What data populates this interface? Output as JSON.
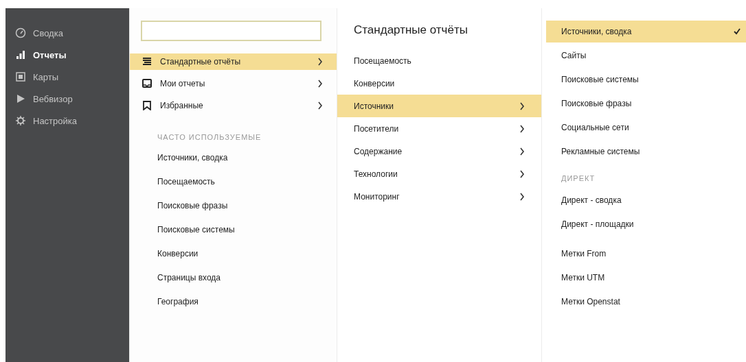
{
  "sidebar": {
    "items": [
      {
        "label": "Сводка",
        "selected": false
      },
      {
        "label": "Отчеты",
        "selected": true
      },
      {
        "label": "Карты",
        "selected": false
      },
      {
        "label": "Вебвизор",
        "selected": false
      },
      {
        "label": "Настройка",
        "selected": false
      }
    ]
  },
  "menu": {
    "items": [
      {
        "label": "Стандартные отчёты",
        "selected": true
      },
      {
        "label": "Мои отчеты",
        "selected": false
      },
      {
        "label": "Избранные",
        "selected": false
      }
    ],
    "frequent": {
      "heading": "ЧАСТО ИСПОЛЬЗУЕМЫЕ",
      "items": [
        "Источники, сводка",
        "Посещаемость",
        "Поисковые фразы",
        "Поисковые системы",
        "Конверсии",
        "Страницы входа",
        "География"
      ]
    }
  },
  "reports": {
    "title": "Стандартные отчёты",
    "items": [
      {
        "label": "Посещаемость",
        "submenu": false,
        "selected": false
      },
      {
        "label": "Конверсии",
        "submenu": false,
        "selected": false
      },
      {
        "label": "Источники",
        "submenu": true,
        "selected": true
      },
      {
        "label": "Посетители",
        "submenu": true,
        "selected": false
      },
      {
        "label": "Содержание",
        "submenu": true,
        "selected": false
      },
      {
        "label": "Технологии",
        "submenu": true,
        "selected": false
      },
      {
        "label": "Мониторинг",
        "submenu": true,
        "selected": false
      }
    ]
  },
  "sources": {
    "sections": [
      {
        "items": [
          {
            "label": "Источники, сводка",
            "selected": true
          },
          {
            "label": "Сайты",
            "selected": false
          },
          {
            "label": "Поисковые системы",
            "selected": false
          },
          {
            "label": "Поисковые фразы",
            "selected": false
          },
          {
            "label": "Социальные сети",
            "selected": false
          },
          {
            "label": "Рекламные системы",
            "selected": false
          }
        ]
      },
      {
        "heading": "ДИРЕКТ",
        "items": [
          {
            "label": "Директ - сводка",
            "selected": false
          },
          {
            "label": "Директ - площадки",
            "selected": false
          }
        ]
      },
      {
        "items": [
          {
            "label": "Метки From",
            "selected": false
          },
          {
            "label": "Метки UTM",
            "selected": false
          },
          {
            "label": "Метки Openstat",
            "selected": false
          }
        ]
      }
    ]
  }
}
